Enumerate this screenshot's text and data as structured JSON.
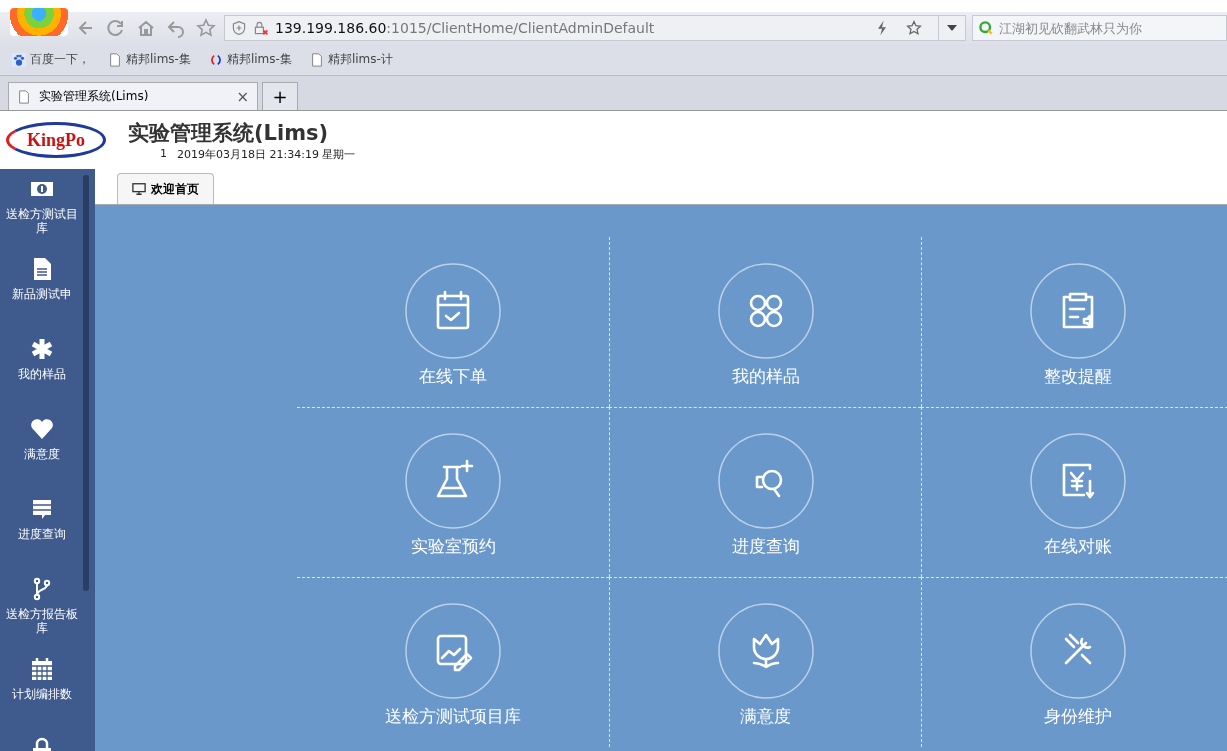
{
  "browser": {
    "url_host": "139.199.186.60",
    "url_path": ":1015/ClientHome/ClientAdminDefault",
    "search_placeholder": "江湖初见砍翻武林只为你",
    "bookmarks": [
      {
        "kind": "paw",
        "label": "百度一下，"
      },
      {
        "kind": "page",
        "label": "精邦lims-集"
      },
      {
        "kind": "swirl",
        "label": "精邦lims-集"
      },
      {
        "kind": "page",
        "label": "精邦lims-计"
      }
    ],
    "tabs": [
      {
        "label": "实验管理系统(Lims)",
        "close": "×",
        "selected": true
      }
    ],
    "new_tab": "+"
  },
  "app": {
    "logo": "KingPo",
    "title": "实验管理系统(Lims)",
    "user": "1",
    "datetime": "2019年03月18日 21:34:19 星期一"
  },
  "sidebar": [
    {
      "kind": "money",
      "label": "送检方测试目库"
    },
    {
      "kind": "doc",
      "label": "新品测试申"
    },
    {
      "kind": "asterisk",
      "label": "我的样品"
    },
    {
      "kind": "heart",
      "label": "满意度"
    },
    {
      "kind": "chat",
      "label": "进度查询"
    },
    {
      "kind": "fork",
      "label": "送检方报告板库"
    },
    {
      "kind": "calendar",
      "label": "计划编排数"
    },
    {
      "kind": "lock"
    }
  ],
  "page_tabs": [
    {
      "label": "欢迎首页",
      "selected": true
    }
  ],
  "tiles": [
    {
      "kind": "calendar",
      "label": "在线下单"
    },
    {
      "kind": "clover",
      "label": "我的样品"
    },
    {
      "kind": "clipboard",
      "label": "整改提醒"
    },
    {
      "kind": "flask",
      "label": "实验室预约"
    },
    {
      "kind": "search",
      "label": "进度查询"
    },
    {
      "kind": "yen",
      "label": "在线对账"
    },
    {
      "kind": "image",
      "label": "送检方测试项目库"
    },
    {
      "kind": "tulip",
      "label": "满意度"
    },
    {
      "kind": "tools",
      "label": "身份维护"
    }
  ]
}
